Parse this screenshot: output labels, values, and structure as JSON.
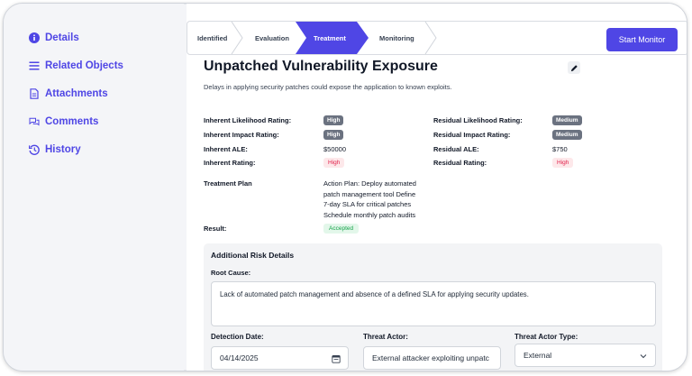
{
  "sidebar": {
    "items": [
      {
        "label": "Details",
        "icon": "info-icon"
      },
      {
        "label": "Related Objects",
        "icon": "list-icon"
      },
      {
        "label": "Attachments",
        "icon": "document-icon"
      },
      {
        "label": "Comments",
        "icon": "comments-icon"
      },
      {
        "label": "History",
        "icon": "history-icon"
      }
    ]
  },
  "stepper": {
    "steps": [
      "Identified",
      "Evaluation",
      "Treatment",
      "Monitoring"
    ],
    "active_step": "Treatment",
    "start_button": "Start Monitor"
  },
  "risk": {
    "title": "Unpatched Vulnerability Exposure",
    "description": "Delays in applying security patches could expose the application to known exploits.",
    "inherent": {
      "likelihood_label": "Inherent Likelihood Rating:",
      "likelihood_value": "High",
      "impact_label": "Inherent Impact Rating:",
      "impact_value": "High",
      "ale_label": "Inherent ALE:",
      "ale_value": "$50000",
      "rating_label": "Inherent Rating:",
      "rating_value": "High"
    },
    "residual": {
      "likelihood_label": "Residual Likelihood Rating:",
      "likelihood_value": "Medium",
      "impact_label": "Residual Impact Rating:",
      "impact_value": "Medium",
      "ale_label": "Residual ALE:",
      "ale_value": "$750",
      "rating_label": "Residual Rating:",
      "rating_value": "High"
    },
    "treatment_plan_label": "Treatment Plan",
    "treatment_plan_lines": [
      "Action Plan: Deploy automated",
      "patch management tool Define",
      "7-day SLA for critical patches",
      "Schedule monthly patch audits"
    ],
    "result_label": "Result:",
    "result_value": "Accepted"
  },
  "additional": {
    "title": "Additional Risk Details",
    "root_cause_label": "Root Cause:",
    "root_cause_value": "Lack of automated patch management and absence of a defined SLA for applying security updates.",
    "detection_date_label": "Detection Date:",
    "detection_date_value": "04/14/2025",
    "threat_actor_label": "Threat Actor:",
    "threat_actor_value": "External attacker exploiting unpatc",
    "threat_actor_type_label": "Threat Actor Type:",
    "threat_actor_type_value": "External"
  },
  "colors": {
    "accent": "#4f46e5",
    "badge_dark": "#6b7280",
    "badge_red_text": "#e11d48",
    "badge_green_text": "#16a34a"
  }
}
